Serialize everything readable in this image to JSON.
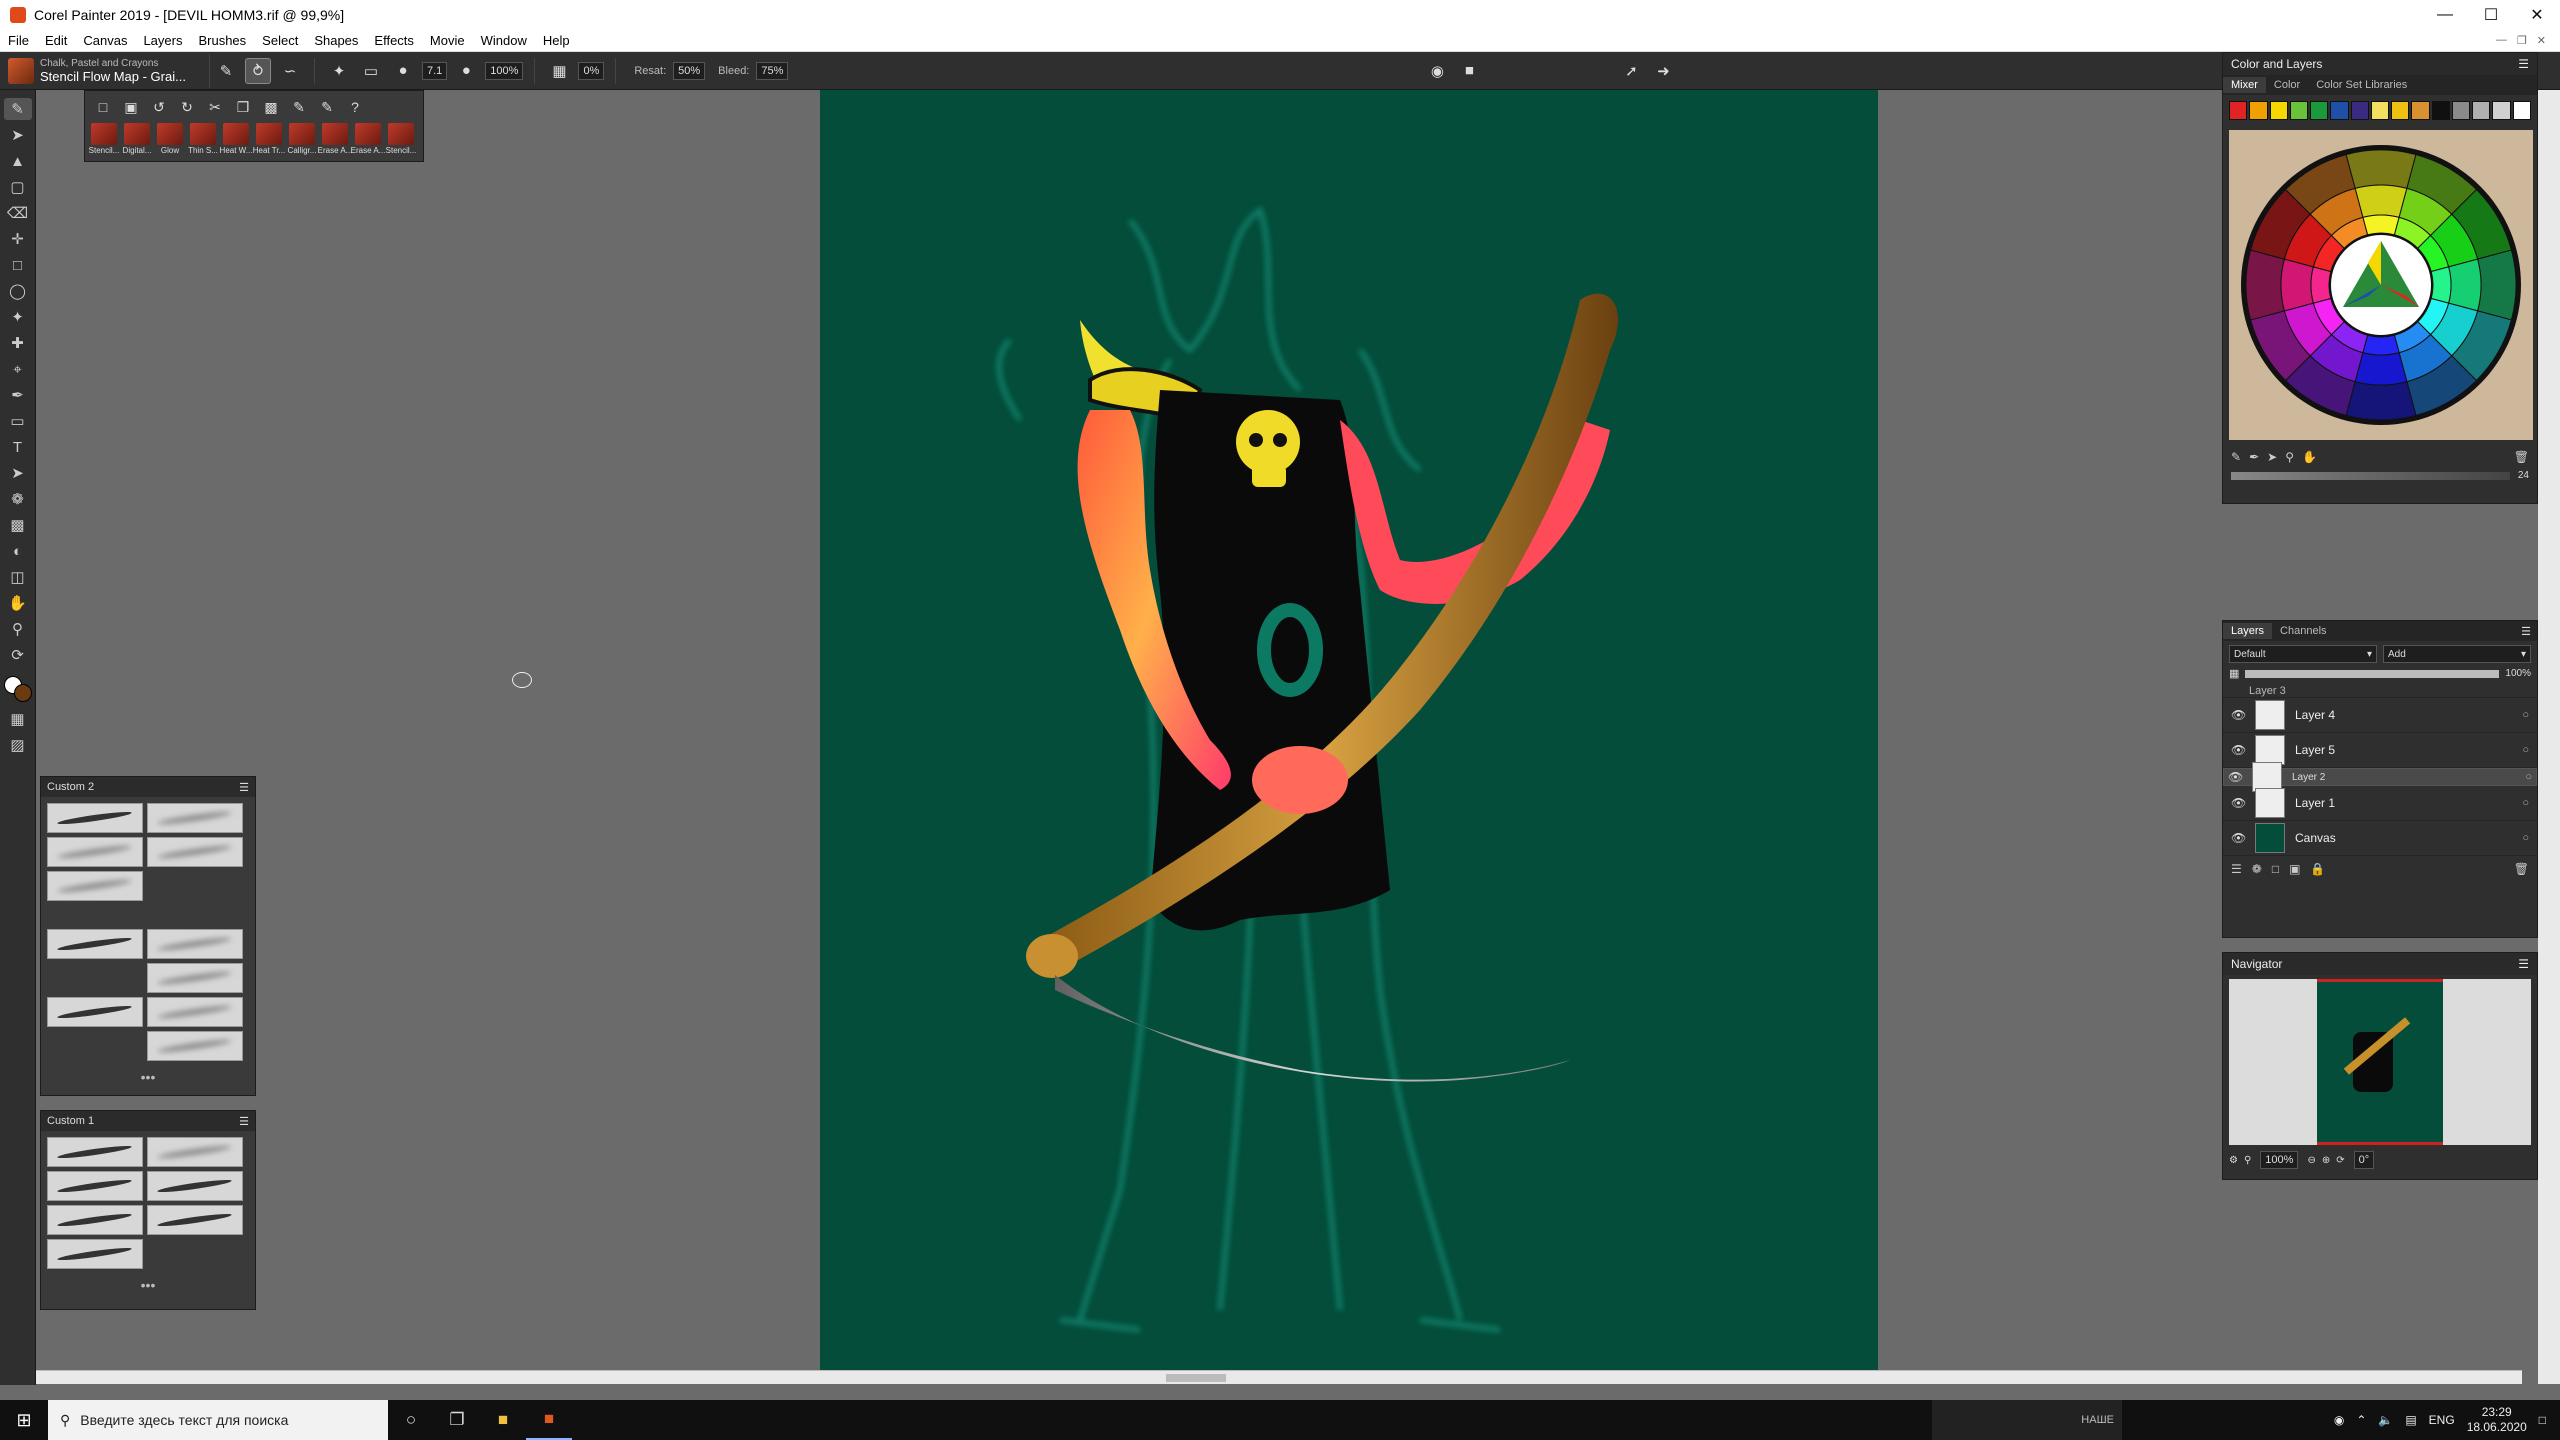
{
  "window": {
    "title": "Corel Painter 2019 - [DEVIL HOMM3.rif @ 99,9%]"
  },
  "menu": [
    "File",
    "Edit",
    "Canvas",
    "Layers",
    "Brushes",
    "Select",
    "Shapes",
    "Effects",
    "Movie",
    "Window",
    "Help"
  ],
  "propbar": {
    "brush_category": "Chalk, Pastel and Crayons",
    "brush_variant": "Stencil Flow Map - Grai...",
    "size": "7.1",
    "opacity": "100%",
    "grain": "0%",
    "resat_label": "Resat:",
    "resat": "50%",
    "bleed_label": "Bleed:",
    "bleed": "75%"
  },
  "brushstrip": {
    "variants": [
      "Stencil...",
      "Digital...",
      "Glow",
      "Thin S...",
      "Heat W...",
      "Heat Tr...",
      "Calligr...",
      "Erase A...",
      "Erase A...",
      "Stencil..."
    ]
  },
  "custom2": {
    "title": "Custom 2"
  },
  "custom1": {
    "title": "Custom 1"
  },
  "color_panel": {
    "title": "Color and Layers",
    "tabs": [
      "Mixer",
      "Color",
      "Color Set Libraries"
    ],
    "chips": [
      "#e02424",
      "#f0a000",
      "#f5d800",
      "#6ac23a",
      "#1a9a3a",
      "#1f4fa8",
      "#3a2a80",
      "#f4e060",
      "#f0c010",
      "#d89030",
      "#101010",
      "#8a8a8a",
      "#b0b0b0",
      "#d0d0d0",
      "#ffffff"
    ],
    "size_value": "24"
  },
  "layers_panel": {
    "tabs": [
      "Layers",
      "Channels"
    ],
    "composite_method": "Default",
    "composite_depth": "Add",
    "opacity": "100%",
    "layers": [
      {
        "name": "Layer 3",
        "selected": false
      },
      {
        "name": "Layer 4",
        "selected": false
      },
      {
        "name": "Layer 5",
        "selected": false
      },
      {
        "name": "Layer 2",
        "selected": true
      },
      {
        "name": "Layer 1",
        "selected": false
      },
      {
        "name": "Canvas",
        "selected": false
      }
    ]
  },
  "navigator": {
    "title": "Navigator",
    "zoom": "100%",
    "rotation": "0°"
  },
  "taskbar": {
    "search_placeholder": "Введите здесь текст для поиска",
    "preview_label": "НАШЕ",
    "lang": "ENG",
    "time": "23:29",
    "date": "18.06.2020"
  }
}
